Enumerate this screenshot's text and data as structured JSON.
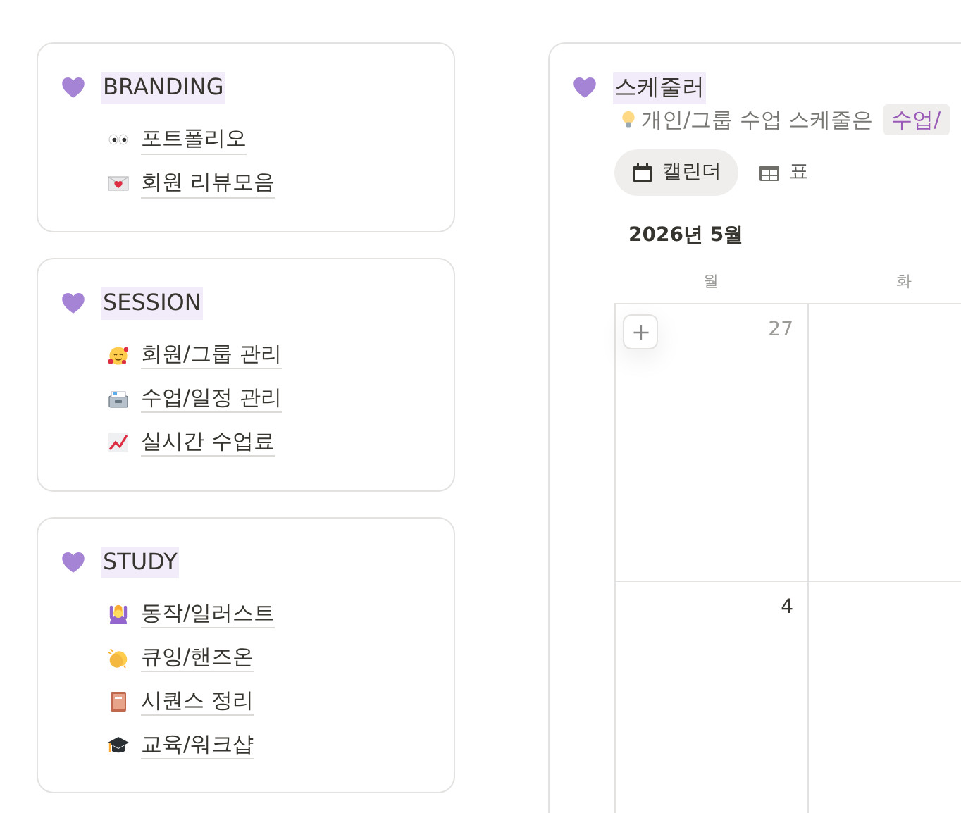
{
  "sections": [
    {
      "title": "BRANDING",
      "links": [
        {
          "label": "포트폴리오"
        },
        {
          "label": "회원 리뷰모음"
        }
      ]
    },
    {
      "title": "SESSION",
      "links": [
        {
          "label": "회원/그룹 관리"
        },
        {
          "label": "수업/일정 관리"
        },
        {
          "label": "실시간 수업료"
        }
      ]
    },
    {
      "title": "STUDY",
      "links": [
        {
          "label": "동작/일러스트"
        },
        {
          "label": "큐잉/핸즈온"
        },
        {
          "label": "시퀀스 정리"
        },
        {
          "label": "교육/워크샵"
        }
      ]
    }
  ],
  "scheduler": {
    "title": "스케줄러",
    "tip": "개인/그룹 수업 스케줄은",
    "chip": "수업/",
    "views": [
      {
        "kind": "calendar",
        "label": "캘린더",
        "selected": true
      },
      {
        "kind": "table",
        "label": "표",
        "selected": false
      }
    ],
    "month": "2026년 5월",
    "weekdays": [
      "월",
      "화"
    ],
    "weeks": [
      {
        "day": "27",
        "other_month": true,
        "add_button": true
      },
      {
        "day": "4",
        "other_month": false,
        "add_button": false
      }
    ]
  }
}
